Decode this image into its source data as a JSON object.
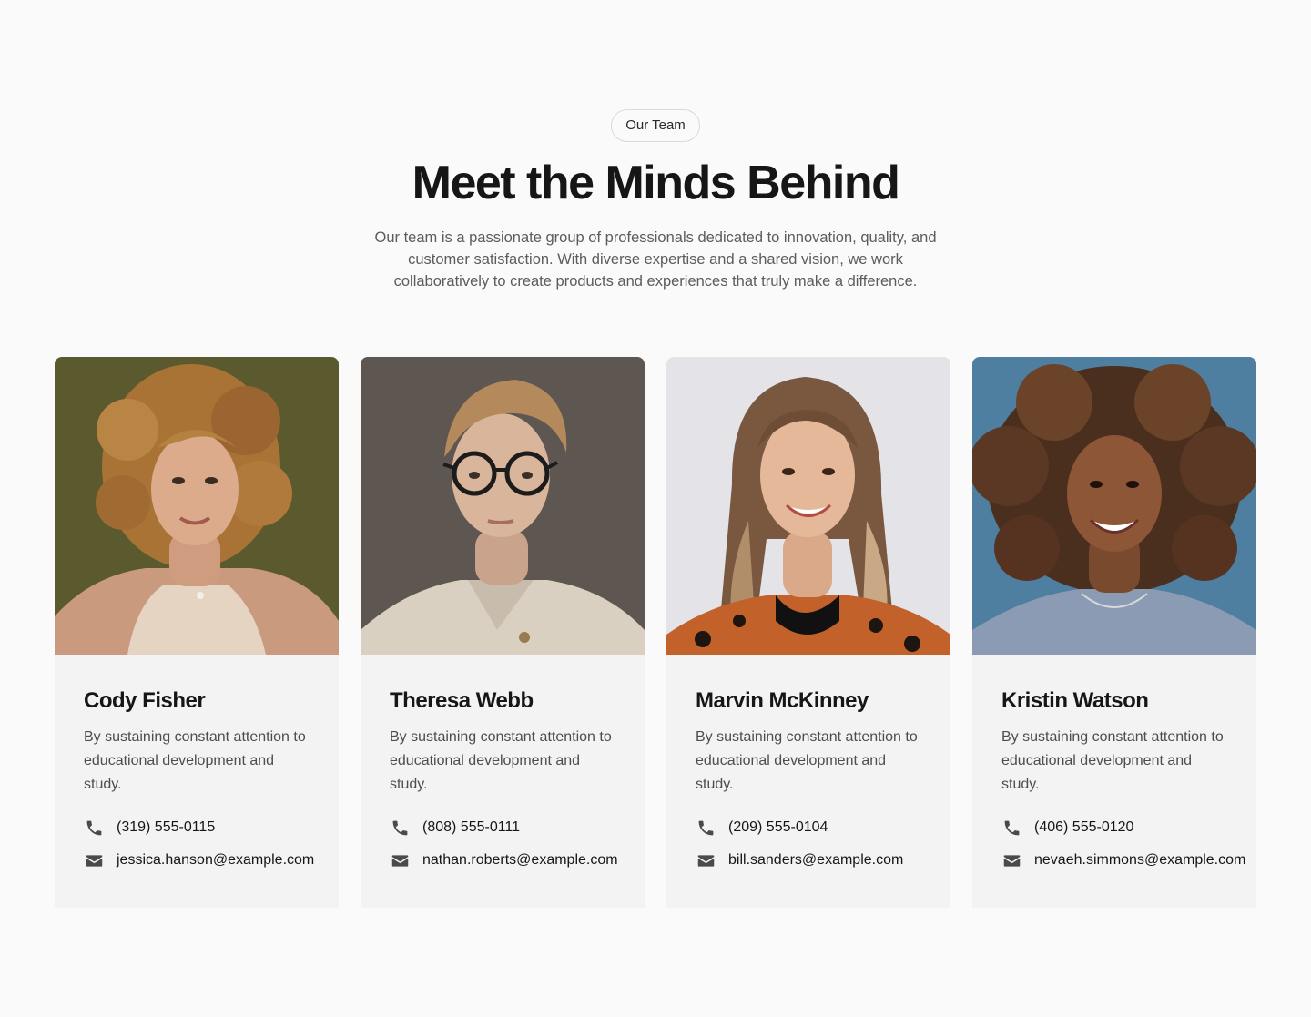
{
  "header": {
    "badge": "Our Team",
    "title": "Meet the Minds Behind",
    "subtitle": "Our team is a passionate group of professionals dedicated to innovation, quality, and customer satisfaction. With diverse expertise and a shared vision, we work collaboratively to create products and experiences that truly make a difference."
  },
  "members": [
    {
      "name": "Cody Fisher",
      "bio": "By sustaining constant attention to educational development and study.",
      "phone": "(319) 555-0115",
      "email": "jessica.hanson@example.com",
      "photo_bg": "#5b5a2e"
    },
    {
      "name": "Theresa Webb",
      "bio": "By sustaining constant attention to educational development and study.",
      "phone": "(808) 555-0111",
      "email": "nathan.roberts@example.com",
      "photo_bg": "#5e5650"
    },
    {
      "name": "Marvin McKinney",
      "bio": "By sustaining constant attention to educational development and study.",
      "phone": "(209) 555-0104",
      "email": "bill.sanders@example.com",
      "photo_bg": "#e4e3e8"
    },
    {
      "name": "Kristin Watson",
      "bio": "By sustaining constant attention to educational development and study.",
      "phone": "(406) 555-0120",
      "email": "nevaeh.simmons@example.com",
      "photo_bg": "#4f7fa0"
    }
  ],
  "icons": {
    "phone": "phone-icon",
    "email": "mail-icon"
  }
}
